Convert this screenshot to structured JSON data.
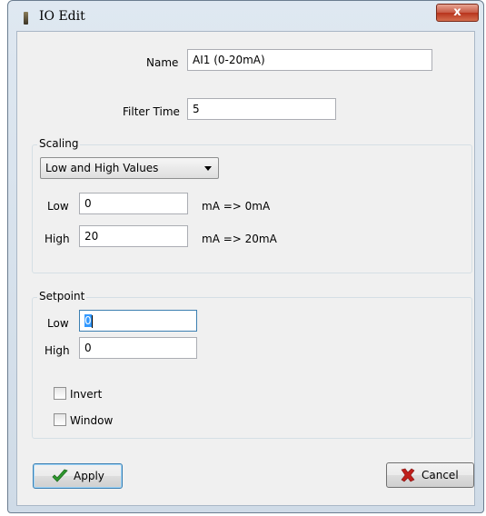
{
  "window": {
    "title": "IO Edit",
    "close_label": "x"
  },
  "form": {
    "name_label": "Name",
    "name_value": "AI1 (0-20mA)",
    "filter_label": "Filter Time",
    "filter_value": "5"
  },
  "scaling": {
    "title": "Scaling",
    "mode_selected": "Low and High Values",
    "low_label": "Low",
    "low_value": "0",
    "low_unit": "mA => 0mA",
    "high_label": "High",
    "high_value": "20",
    "high_unit": "mA => 20mA"
  },
  "setpoint": {
    "title": "Setpoint",
    "low_label": "Low",
    "low_value": "0",
    "high_label": "High",
    "high_value": "0",
    "invert_label": "Invert",
    "invert_checked": false,
    "window_label": "Window",
    "window_checked": false
  },
  "buttons": {
    "apply_label": "Apply",
    "cancel_label": "Cancel"
  },
  "colors": {
    "apply_icon": "#2e9a2e",
    "cancel_icon": "#c0201c",
    "selection": "#3399ff"
  }
}
